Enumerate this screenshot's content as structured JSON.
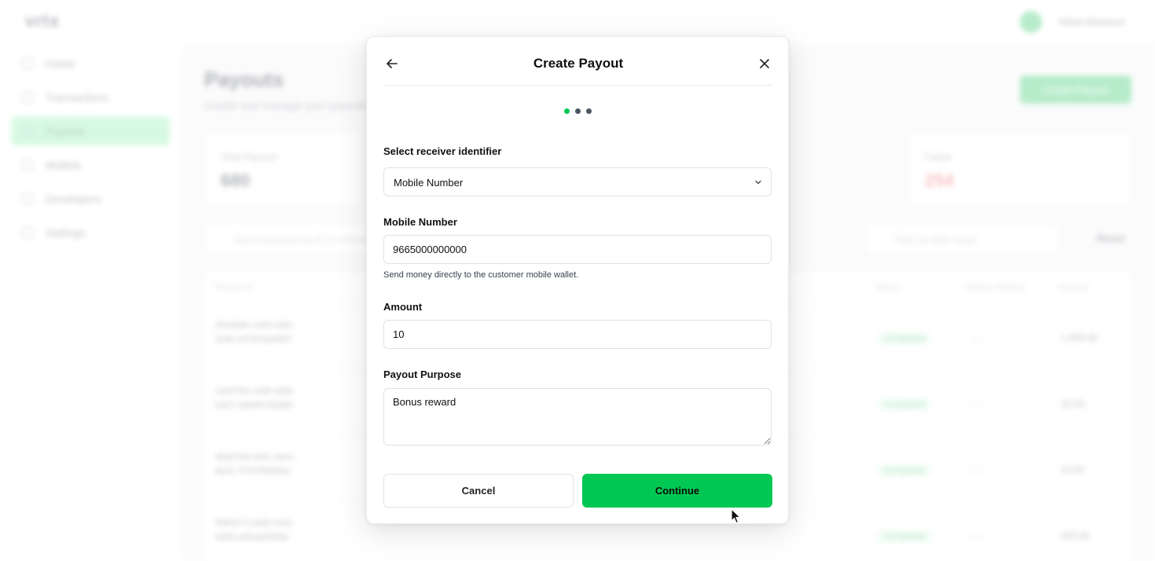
{
  "app": {
    "logo": "vrtx",
    "user_name": "Yahia Mansour",
    "sidebar": [
      {
        "label": "Home",
        "active": false
      },
      {
        "label": "Transactions",
        "active": false
      },
      {
        "label": "Payouts",
        "active": true
      },
      {
        "label": "Wallets",
        "active": false
      },
      {
        "label": "Developers",
        "active": false
      },
      {
        "label": "Settings",
        "active": false
      }
    ],
    "page_title": "Payouts",
    "page_subtitle": "Create and manage your payouts",
    "create_button": "Create Payout",
    "stats": [
      {
        "label": "Total Payouts",
        "value": "680"
      },
      {
        "label": "Failed",
        "value": "254"
      }
    ],
    "search_placeholder": "Search payouts by ID or reference",
    "date_placeholder": "Filter by date range",
    "reset_label": "Reset",
    "table_headers": [
      "Payout ID",
      "Status",
      "Failure Reason",
      "Amount"
    ],
    "rows": [
      {
        "id": "ef5a4fa6-c4d4-4a5c-9cd0-cd7403ab66f7",
        "status": "Completed",
        "reason": "—",
        "amount": "1,000.00"
      },
      {
        "id": "2a4f7fd3-c0d8-4d6b-b2d7-3ab0f5782d85",
        "status": "Completed",
        "reason": "—",
        "amount": "10.00"
      },
      {
        "id": "9bb87fa5-0f61-4ec0-9e02-7f7d7f55d95a",
        "status": "Completed",
        "reason": "—",
        "amount": "10.00"
      },
      {
        "id": "5f9f3a71-6a80-4c9c-9d68-a5f0aa5f3fa9",
        "status": "Completed",
        "reason": "—",
        "amount": "300.00"
      }
    ]
  },
  "modal": {
    "title": "Create Payout",
    "steps_total": 3,
    "current_step": 1,
    "identifier_label": "Select receiver identifier",
    "identifier_value": "Mobile Number",
    "mobile_label": "Mobile Number",
    "mobile_value": "9665000000000",
    "mobile_hint": "Send money directly to the customer mobile wallet.",
    "amount_label": "Amount",
    "amount_value": "10",
    "purpose_label": "Payout Purpose",
    "purpose_value": "Bonus reward",
    "cancel_label": "Cancel",
    "continue_label": "Continue"
  },
  "colors": {
    "accent": "#00c853",
    "step_inactive": "#4b5563",
    "failed": "#ef4444"
  },
  "icons": {
    "back": "arrow-left-icon",
    "close": "close-icon",
    "select": "chevron-down-icon"
  }
}
